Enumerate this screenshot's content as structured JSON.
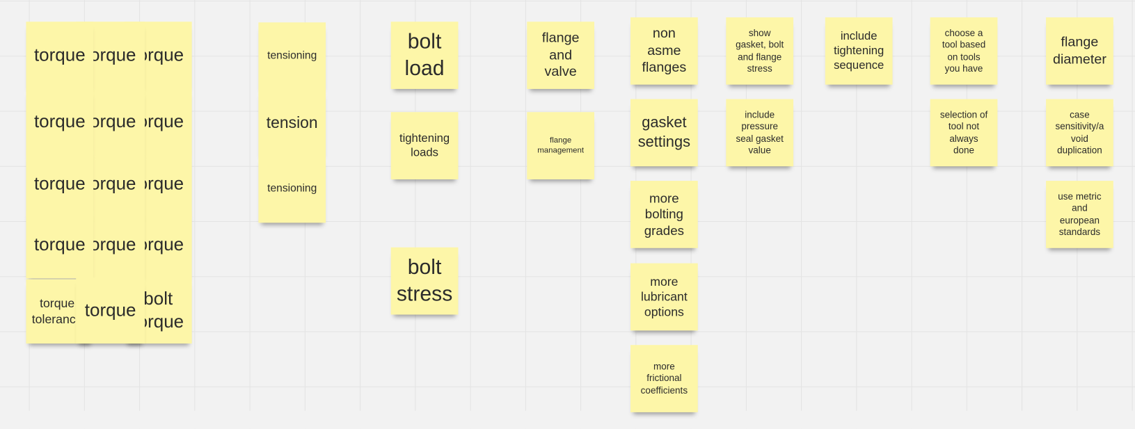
{
  "board": {
    "note_color": "#fdf6a8",
    "background": "#f2f2f2"
  },
  "notes": [
    "torque",
    "torque",
    "torque",
    "torque",
    "torque\ntolerance",
    "torque",
    "torque",
    "torque",
    "torque",
    "torque",
    "torque",
    "torque",
    "torque",
    "torque",
    "bolt\ntorque",
    "tensioning",
    "tension",
    "tensioning",
    "bolt\nload",
    "tightening\nloads",
    "bolt\nstress",
    "flange\nand\nvalve",
    "flange\nmanagement",
    "non\nasme\nflanges",
    "gasket\nsettings",
    "more\nbolting\ngrades",
    "more\nlubricant\noptions",
    "more\nfrictional\ncoefficients",
    "show\ngasket, bolt\nand flange\nstress",
    "include\npressure\nseal gasket\nvalue",
    "include\ntightening\nsequence",
    "choose a\ntool based\non tools\nyou have",
    "selection of\ntool not\nalways\ndone",
    "flange\ndiameter",
    "case\nsensitivity/a\nvoid\nduplication",
    "use metric\nand\neuropean\nstandards"
  ]
}
